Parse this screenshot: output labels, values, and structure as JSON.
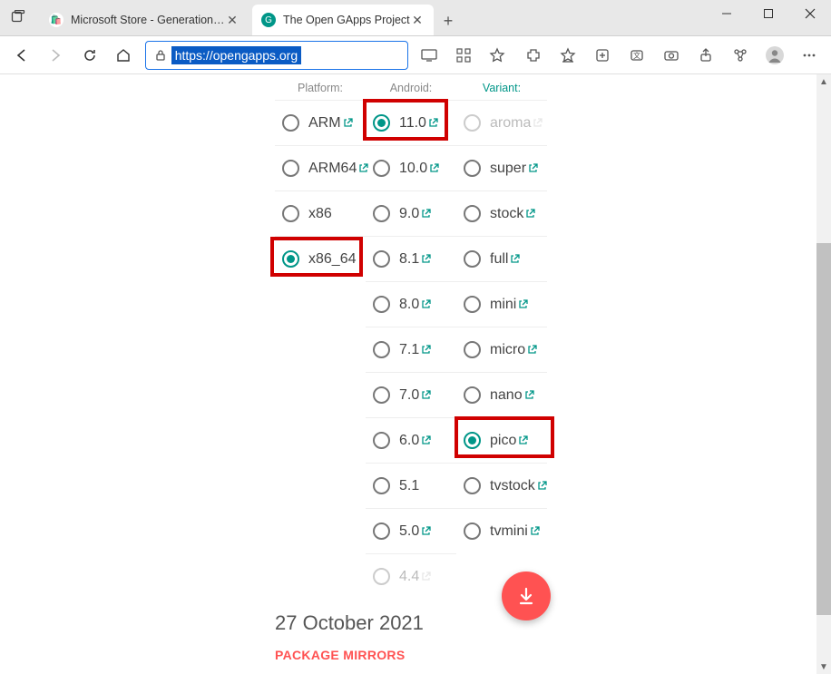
{
  "browser": {
    "tabs": [
      {
        "title": "Microsoft Store - Generation Pro",
        "active": false
      },
      {
        "title": "The Open GApps Project",
        "active": true
      }
    ],
    "url": "https://opengapps.org"
  },
  "page": {
    "headers": {
      "platform": "Platform:",
      "android": "Android:",
      "variant": "Variant:"
    },
    "columns": {
      "platform": [
        {
          "label": "ARM",
          "selected": false,
          "ext": true
        },
        {
          "label": "ARM64",
          "selected": false,
          "ext": true
        },
        {
          "label": "x86",
          "selected": false,
          "ext": false
        },
        {
          "label": "x86_64",
          "selected": true,
          "ext": false
        }
      ],
      "android": [
        {
          "label": "11.0",
          "selected": true,
          "ext": true
        },
        {
          "label": "10.0",
          "selected": false,
          "ext": true
        },
        {
          "label": "9.0",
          "selected": false,
          "ext": true
        },
        {
          "label": "8.1",
          "selected": false,
          "ext": true
        },
        {
          "label": "8.0",
          "selected": false,
          "ext": true
        },
        {
          "label": "7.1",
          "selected": false,
          "ext": true
        },
        {
          "label": "7.0",
          "selected": false,
          "ext": true
        },
        {
          "label": "6.0",
          "selected": false,
          "ext": true
        },
        {
          "label": "5.1",
          "selected": false,
          "ext": false
        },
        {
          "label": "5.0",
          "selected": false,
          "ext": true
        },
        {
          "label": "4.4",
          "selected": false,
          "ext": true,
          "disabled": true
        }
      ],
      "variant": [
        {
          "label": "aroma",
          "selected": false,
          "ext": true,
          "disabled": true
        },
        {
          "label": "super",
          "selected": false,
          "ext": true
        },
        {
          "label": "stock",
          "selected": false,
          "ext": true
        },
        {
          "label": "full",
          "selected": false,
          "ext": true
        },
        {
          "label": "mini",
          "selected": false,
          "ext": true
        },
        {
          "label": "micro",
          "selected": false,
          "ext": true
        },
        {
          "label": "nano",
          "selected": false,
          "ext": true
        },
        {
          "label": "pico",
          "selected": true,
          "ext": true
        },
        {
          "label": "tvstock",
          "selected": false,
          "ext": true
        },
        {
          "label": "tvmini",
          "selected": false,
          "ext": true
        }
      ]
    },
    "release_date": "27 October 2021",
    "mirrors_label": "PACKAGE MIRRORS"
  }
}
